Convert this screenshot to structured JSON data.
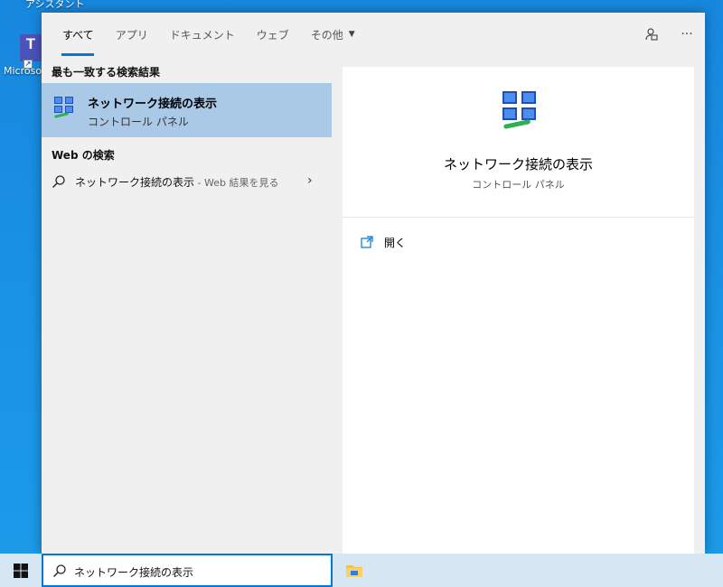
{
  "desktop": {
    "top_label": "アシスタント",
    "icon_label": "Microsoft"
  },
  "tabs": [
    {
      "label": "すべて",
      "active": true
    },
    {
      "label": "アプリ"
    },
    {
      "label": "ドキュメント"
    },
    {
      "label": "ウェブ"
    },
    {
      "label": "その他"
    }
  ],
  "tab_more_caret": "▼",
  "actions": {
    "feedback_icon": "feedback-icon",
    "more_label": "···"
  },
  "results": {
    "best_match_header": "最も一致する検索結果",
    "best_match": {
      "title": "ネットワーク接続の表示",
      "subtitle": "コントロール パネル",
      "icon": "network-connections-icon"
    },
    "web_header": "Web の検索",
    "web_item": {
      "query": "ネットワーク接続の表示",
      "suffix": " - Web 結果を見る",
      "chevron": "›"
    }
  },
  "detail": {
    "title": "ネットワーク接続の表示",
    "subtitle": "コントロール パネル",
    "open_label": "開く"
  },
  "taskbar": {
    "search_value": "ネットワーク接続の表示"
  },
  "colors": {
    "accent": "#0078d7",
    "selected": "#a9c9e7",
    "desktop": "#1a8fe0"
  }
}
